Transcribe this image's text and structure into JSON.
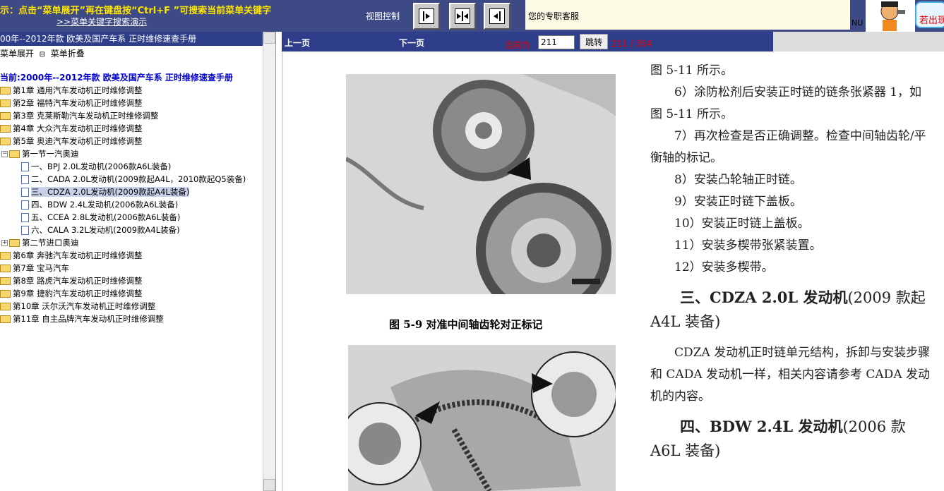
{
  "topbar": {
    "tip": "示：点击“菜单展开”再在键盘按“Ctrl+F ”可搜索当前菜单关键字",
    "demo_link": ">>菜单关键字搜索演示",
    "view_label": "视图控制",
    "service_text": "您的专职客服",
    "nu_text": "NU",
    "contact_text": "若出现"
  },
  "left_panel": {
    "title": "00年--2012年款 欧美及国产车系 正时维修速查手册",
    "expand_label": "菜单展开",
    "collapse_label": "菜单折叠",
    "current": "当前:2000年--2012年款 欧美及国产车系 正时维修速查手册",
    "tree": [
      {
        "label": "第1章  通用汽车发动机正时维修调整"
      },
      {
        "label": "第2章  福特汽车发动机正时维修调整"
      },
      {
        "label": "第3章  克莱斯勒汽车发动机正时维修调整"
      },
      {
        "label": "第4章  大众汽车发动机正时维修调整"
      },
      {
        "label": "第5章  奥迪汽车发动机正时维修调整"
      },
      {
        "label": "第一节一汽奥迪"
      },
      {
        "label": "一、BPJ 2.0L发动机(2006款A6L装备)"
      },
      {
        "label": "二、CADA 2.0L发动机(2009款起A4L，2010款起Q5装备)"
      },
      {
        "label": "三、CDZA 2.0L发动机(2009款起A4L装备)"
      },
      {
        "label": "四、BDW 2.4L发动机(2006款A6L装备)"
      },
      {
        "label": "五、CCEA 2.8L发动机(2006款A6L装备)"
      },
      {
        "label": "六、CALA 3.2L发动机(2009款A4L装备)"
      },
      {
        "label": "第二节进口奥迪"
      },
      {
        "label": "第6章  奔驰汽车发动机正时维修调整"
      },
      {
        "label": "第7章  宝马汽车"
      },
      {
        "label": "第8章  路虎汽车发动机正时维修调整"
      },
      {
        "label": "第9章  捷豹汽车发动机正时维修调整"
      },
      {
        "label": "第10章  沃尔沃汽车发动机正时维修调整"
      },
      {
        "label": "第11章  自主品牌汽车发动机正时维修调整"
      }
    ]
  },
  "navbar": {
    "prev": "上一页",
    "next": "下一页",
    "current_label": "当前为",
    "page_value": "211",
    "jump": "跳转",
    "page_count": "211 / 354"
  },
  "document": {
    "figure_caption": "图 5-9   对准中间轴齿轮对正标记",
    "paragraphs": [
      "图 5-11 所示。",
      "6）涂防松剂后安装正时链的链条张紧器 1，如图 5-11 所示。",
      "7）再次检查是否正确调整。检查中间轴齿轮/平衡轴的标记。",
      "8）安装凸轮轴正时链。",
      "9）安装正时链下盖板。",
      "10）安装正时链上盖板。",
      "11）安装多楔带张紧装置。",
      "12）安装多楔带。"
    ],
    "heading3_bold": "三、CDZA 2.0L 发动机",
    "heading3_normal": "(2009 款起 A4L 装备)",
    "para_cdza": "CDZA 发动机正时链单元结构，拆卸与安装步骤和 CADA 发动机一样，相关内容请参考 CADA 发动机的内容。",
    "heading4_bold": "四、BDW 2.4L 发动机",
    "heading4_normal": "(2006 款 A6L 装备)"
  }
}
